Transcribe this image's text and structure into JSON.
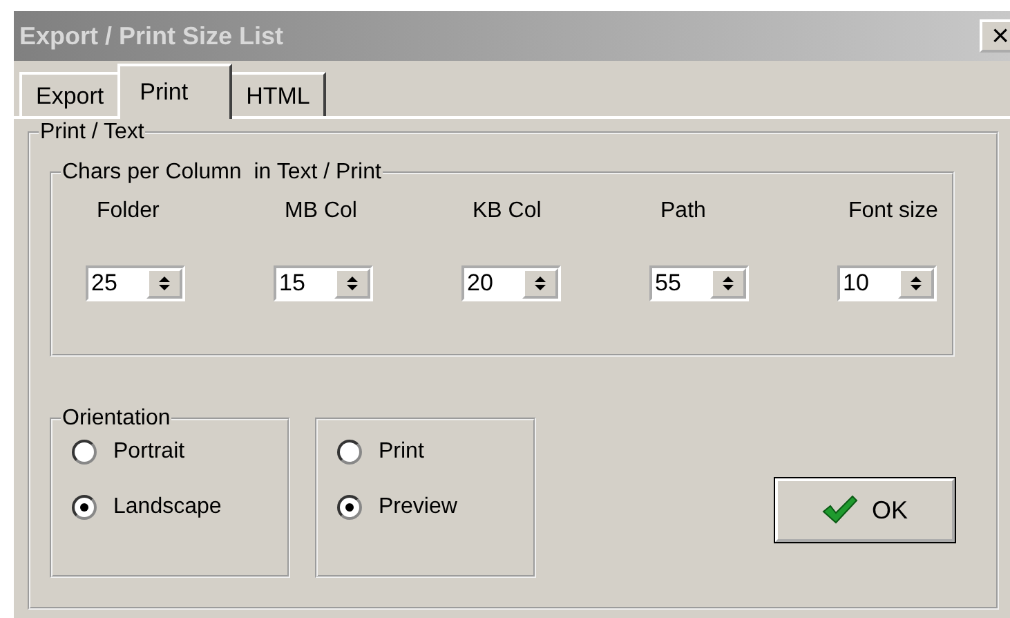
{
  "window": {
    "title": "Export / Print Size List",
    "close": "×"
  },
  "tabs": [
    {
      "label": "Export",
      "selected": false
    },
    {
      "label": "Print",
      "selected": true
    },
    {
      "label": "HTML",
      "selected": false
    }
  ],
  "print_text": {
    "title": "Print / Text",
    "chars_per_column": {
      "title": "Chars per Column  in Text / Print",
      "fields": [
        {
          "label": "Folder",
          "value": "25"
        },
        {
          "label": "MB Col",
          "value": "15"
        },
        {
          "label": "KB Col",
          "value": "20"
        },
        {
          "label": "Path",
          "value": "55"
        },
        {
          "label": "Font size",
          "value": "10"
        }
      ]
    },
    "orientation": {
      "title": "Orientation",
      "options": [
        {
          "label": "Portrait",
          "selected": false
        },
        {
          "label": "Landscape",
          "selected": true
        }
      ]
    },
    "output": {
      "options": [
        {
          "label": "Print",
          "selected": false
        },
        {
          "label": "Preview",
          "selected": true
        }
      ]
    }
  },
  "buttons": [
    {
      "label": "OK"
    }
  ]
}
